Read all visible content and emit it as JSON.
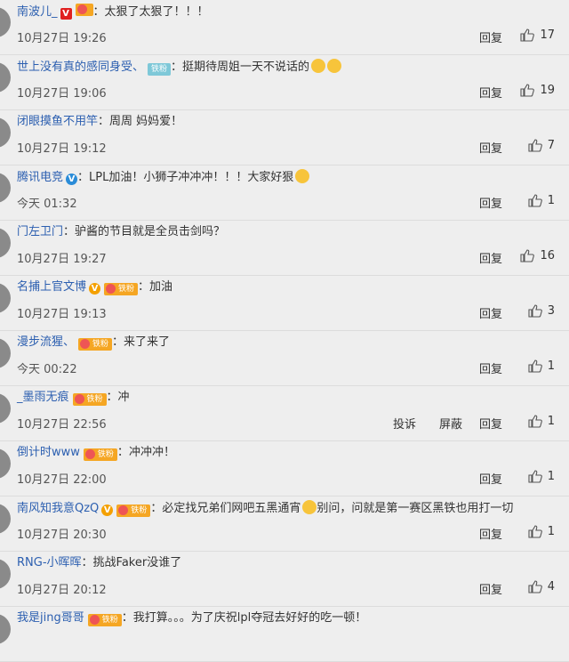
{
  "comments": [
    {
      "user": "南波儿_",
      "badge": "red",
      "fan": "orange",
      "text": "太狠了太狠了！！！",
      "time": "10月27日 19:26",
      "reply": "回复",
      "likes": "17"
    },
    {
      "user": "世上没有真的感同身受、",
      "fan_label": "铁粉",
      "text": "挺期待周姐一天不说话的",
      "emoji": 2,
      "time": "10月27日 19:06",
      "reply": "回复",
      "likes": "19"
    },
    {
      "user": "闭眼摸鱼不用竿",
      "text": "周周 妈妈爱！",
      "time": "10月27日 19:12",
      "reply": "回复",
      "likes": "7"
    },
    {
      "user": "腾讯电竞",
      "badge": "blue",
      "text": "LPL加油！小狮子冲冲冲！！！大家好狠",
      "emoji": 1,
      "time": "今天 01:32",
      "reply": "回复",
      "likes": "1"
    },
    {
      "user": "门左卫门",
      "text": "驴酱的节目就是全员击剑吗？",
      "time": "10月27日 19:27",
      "reply": "回复",
      "likes": "16"
    },
    {
      "user": "名捕上官文博",
      "badge": "orange",
      "fan": "orange",
      "fan_label": "铁粉",
      "text": "加油",
      "time": "10月27日 19:13",
      "reply": "回复",
      "likes": "3"
    },
    {
      "user": "漫步流猩、",
      "fan": "orange",
      "fan_label": "铁粉",
      "text": "来了来了",
      "time": "今天 00:22",
      "reply": "回复",
      "likes": "1"
    },
    {
      "user": "_墨雨无痕",
      "fan": "orange",
      "fan_label": "铁粉",
      "text": "冲",
      "time": "10月27日 22:56",
      "report": "投诉",
      "block": "屏蔽",
      "reply": "回复",
      "likes": "1"
    },
    {
      "user": "倒计时www",
      "fan": "orange",
      "fan_label": "铁粉",
      "text": "冲冲冲！",
      "time": "10月27日 22:00",
      "reply": "回复",
      "likes": "1"
    },
    {
      "user": "南风知我意QzQ",
      "badge": "orange",
      "fan": "orange",
      "fan_label": "铁粉",
      "text": "必定找兄弟们网吧五黑通宵",
      "emoji": 1,
      "text2": "别问，问就是第一赛区黑铁也用打一切",
      "time": "10月27日 20:30",
      "reply": "回复",
      "likes": "1"
    },
    {
      "user": "RNG-小晖晖",
      "text": "挑战Faker没谁了",
      "time": "10月27日 20:12",
      "reply": "回复",
      "likes": "4"
    },
    {
      "user": "我是jing哥哥",
      "fan": "orange",
      "fan_label": "铁粉",
      "text": "我打算。。。为了庆祝lpl夺冠去好好的吃一顿！",
      "time": "",
      "reply": "",
      "likes": ""
    }
  ]
}
